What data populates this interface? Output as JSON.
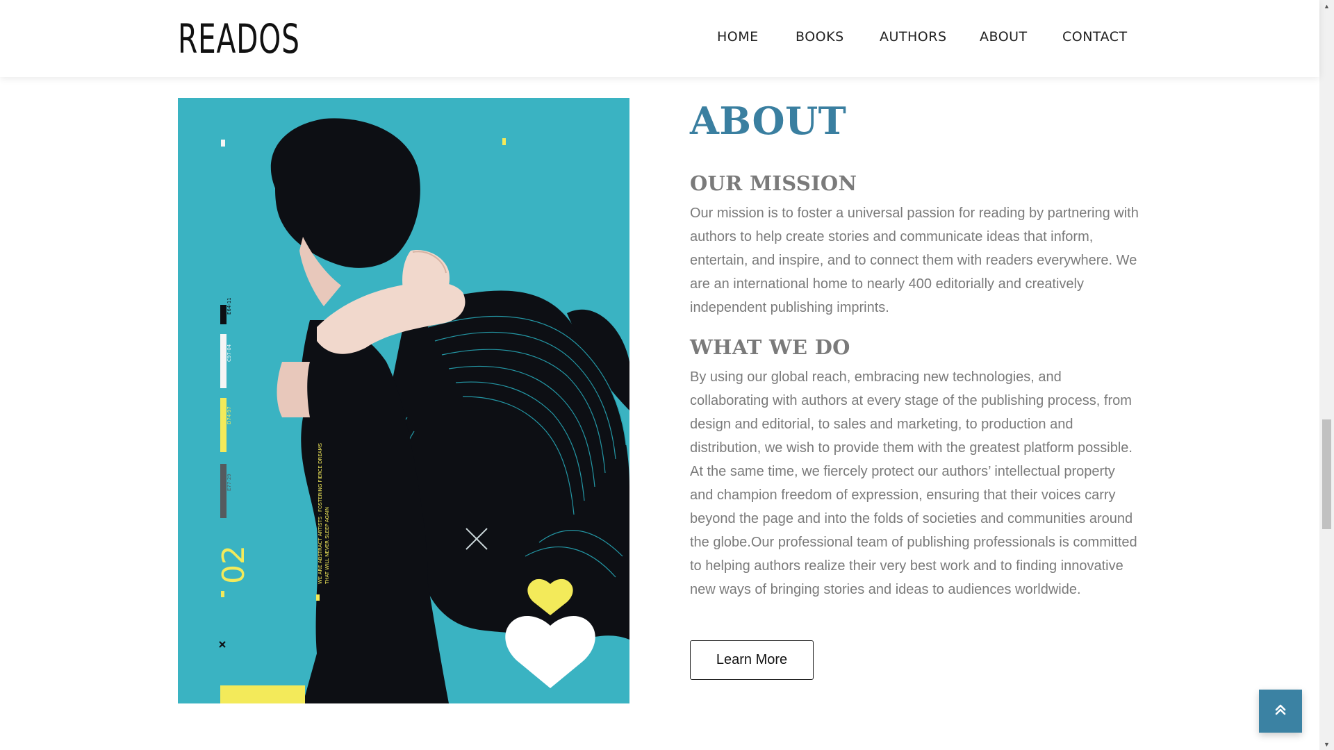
{
  "header": {
    "logo": "READOS",
    "nav": [
      "HOME",
      "BOOKS",
      "AUTHORS",
      "ABOUT",
      "CONTACT"
    ]
  },
  "poster": {
    "number": "02",
    "vertical_text": "WE ARE ABSTRACT ARTISTS · FOSTERING FIERCE DREAMS THAT WILL NEVER SLEEP AGAIN",
    "bar_codes": [
      "E64-11",
      "C97-04",
      "D74-97",
      "E77-29"
    ],
    "colors": {
      "background": "#3ab3c2",
      "accent": "#f3ea5a",
      "ink": "#0d0f14"
    }
  },
  "about": {
    "title": "ABOUT",
    "mission_title": "OUR MISSION",
    "mission_text": "Our mission is to foster a universal passion for reading by partnering with authors to help create stories and communicate ideas that inform, entertain, and inspire, and to connect them with readers everywhere. We are an international home to nearly 400 editorially and creatively independent publishing imprints.",
    "what_title": "WHAT WE DO",
    "what_text": "By using our global reach, embracing new technologies, and collaborating with authors at every stage of the publishing process, from design and editorial, to sales and marketing, to production and distribution, we wish to provide them with the greatest platform possible. At the same time, we fiercely protect our authors’ intellectual property and champion freedom of expression, ensuring that their voices carry beyond the page and into the folds of societies and communities around the globe.Our professional team of publishing professionals is committed to helping authors realize their very best work and to finding innovative new ways of bringing stories and ideas to audiences worldwide.",
    "button": "Learn More"
  },
  "scroll_top": {
    "icon": "double-chevron-up-icon"
  },
  "colors": {
    "accent": "#3a7fa0",
    "text": "#7a7a7a",
    "scroll_top_bg": "#3b82a3"
  }
}
